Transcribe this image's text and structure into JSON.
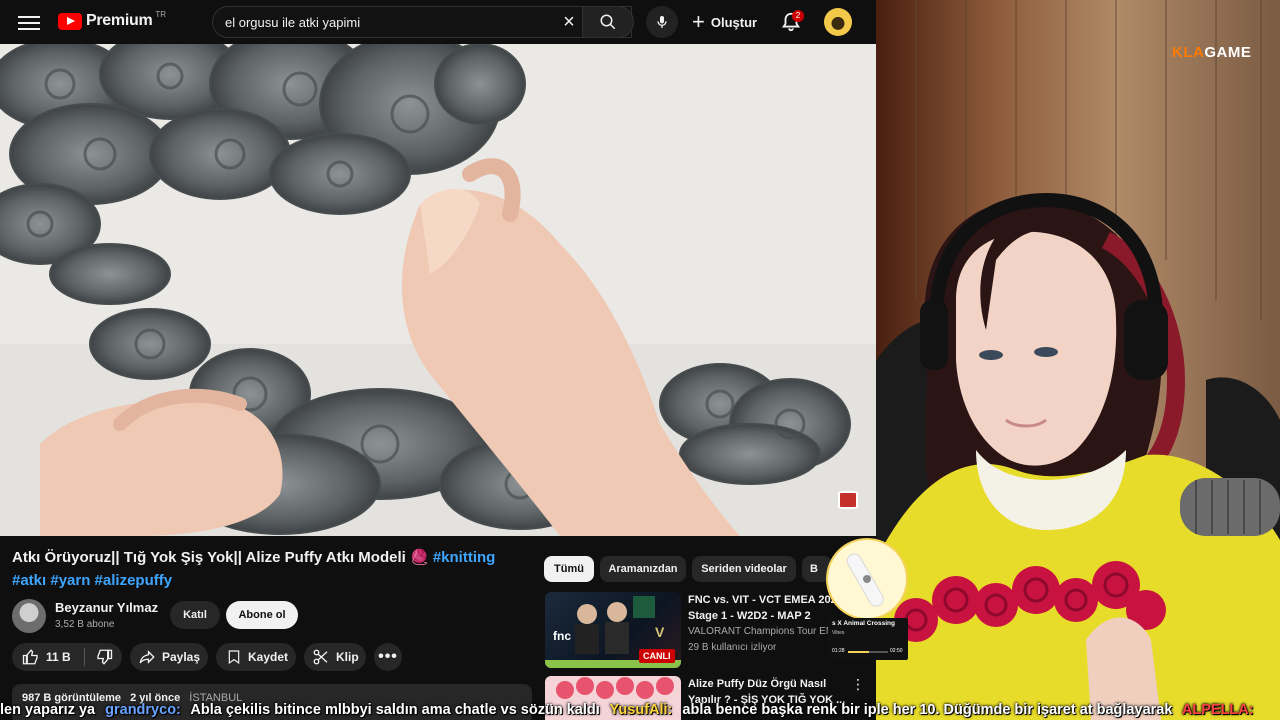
{
  "topbar": {
    "logo_text": "Premium",
    "region": "TR",
    "search_value": "el orgusu ile atki yapimi",
    "create_label": "Oluştur",
    "notifications_count": "2"
  },
  "video": {
    "title_text": "Atkı Örüyoruz|| Tığ Yok Şiş Yok|| Alize Puffy Atkı Modeli 🧶",
    "hashtags_line1": "#knitting",
    "hashtags_line2": "#atkı #yarn #alizepuffy",
    "channel_name": "Beyzanur Yılmaz",
    "subscribers": "3,52 B abone",
    "join_label": "Katıl",
    "subscribe_label": "Abone ol",
    "likes": "11 B",
    "share_label": "Paylaş",
    "save_label": "Kaydet",
    "clip_label": "Klip",
    "views": "987 B görüntüleme",
    "age": "2 yıl önce",
    "location": "İSTANBUL"
  },
  "chips": [
    "Tümü",
    "Aramanızdan",
    "Seriden videolar",
    "B"
  ],
  "recommendations": [
    {
      "title": "FNC vs. VIT - VCT EMEA 2025 Stage 1 - W2D2 - MAP 2",
      "channel": "VALORANT Champions Tour EM",
      "meta": "29 B kullanıcı izliyor",
      "badge": "CANLI"
    },
    {
      "title": "Alize Puffy Düz Örgü Nasıl Yapılır ? - ŞİŞ YOK TIĞ YOK ..."
    }
  ],
  "stream": {
    "brand_a": "KLA",
    "brand_b": "GAME"
  },
  "widget": {
    "title": "s X Animal Crossing",
    "sub": "Vibes",
    "time_start": "01:28",
    "time_end": "02:50",
    "progress": 0.52
  },
  "chat": [
    {
      "user": "",
      "msg": "len yaparız ya",
      "ucls": "msg"
    },
    {
      "user": "grandryco:",
      "msg": "Abla çekilis bitince mlbbyi saldın ama chatle vs sözün kaldı",
      "ucls": "u1"
    },
    {
      "user": "YusufAli:",
      "msg": "abla bence başka renk bir iple her 10. Düğümde bir işaret at bağlayarak",
      "ucls": "u2"
    },
    {
      "user": "ALPELLA:",
      "msg": "",
      "ucls": "u3"
    }
  ],
  "colors": {
    "yt_bg": "#0f0f0f",
    "accent_red": "#ff0000",
    "link_blue": "#3ea6ff",
    "brand_orange": "#ff7a00"
  }
}
